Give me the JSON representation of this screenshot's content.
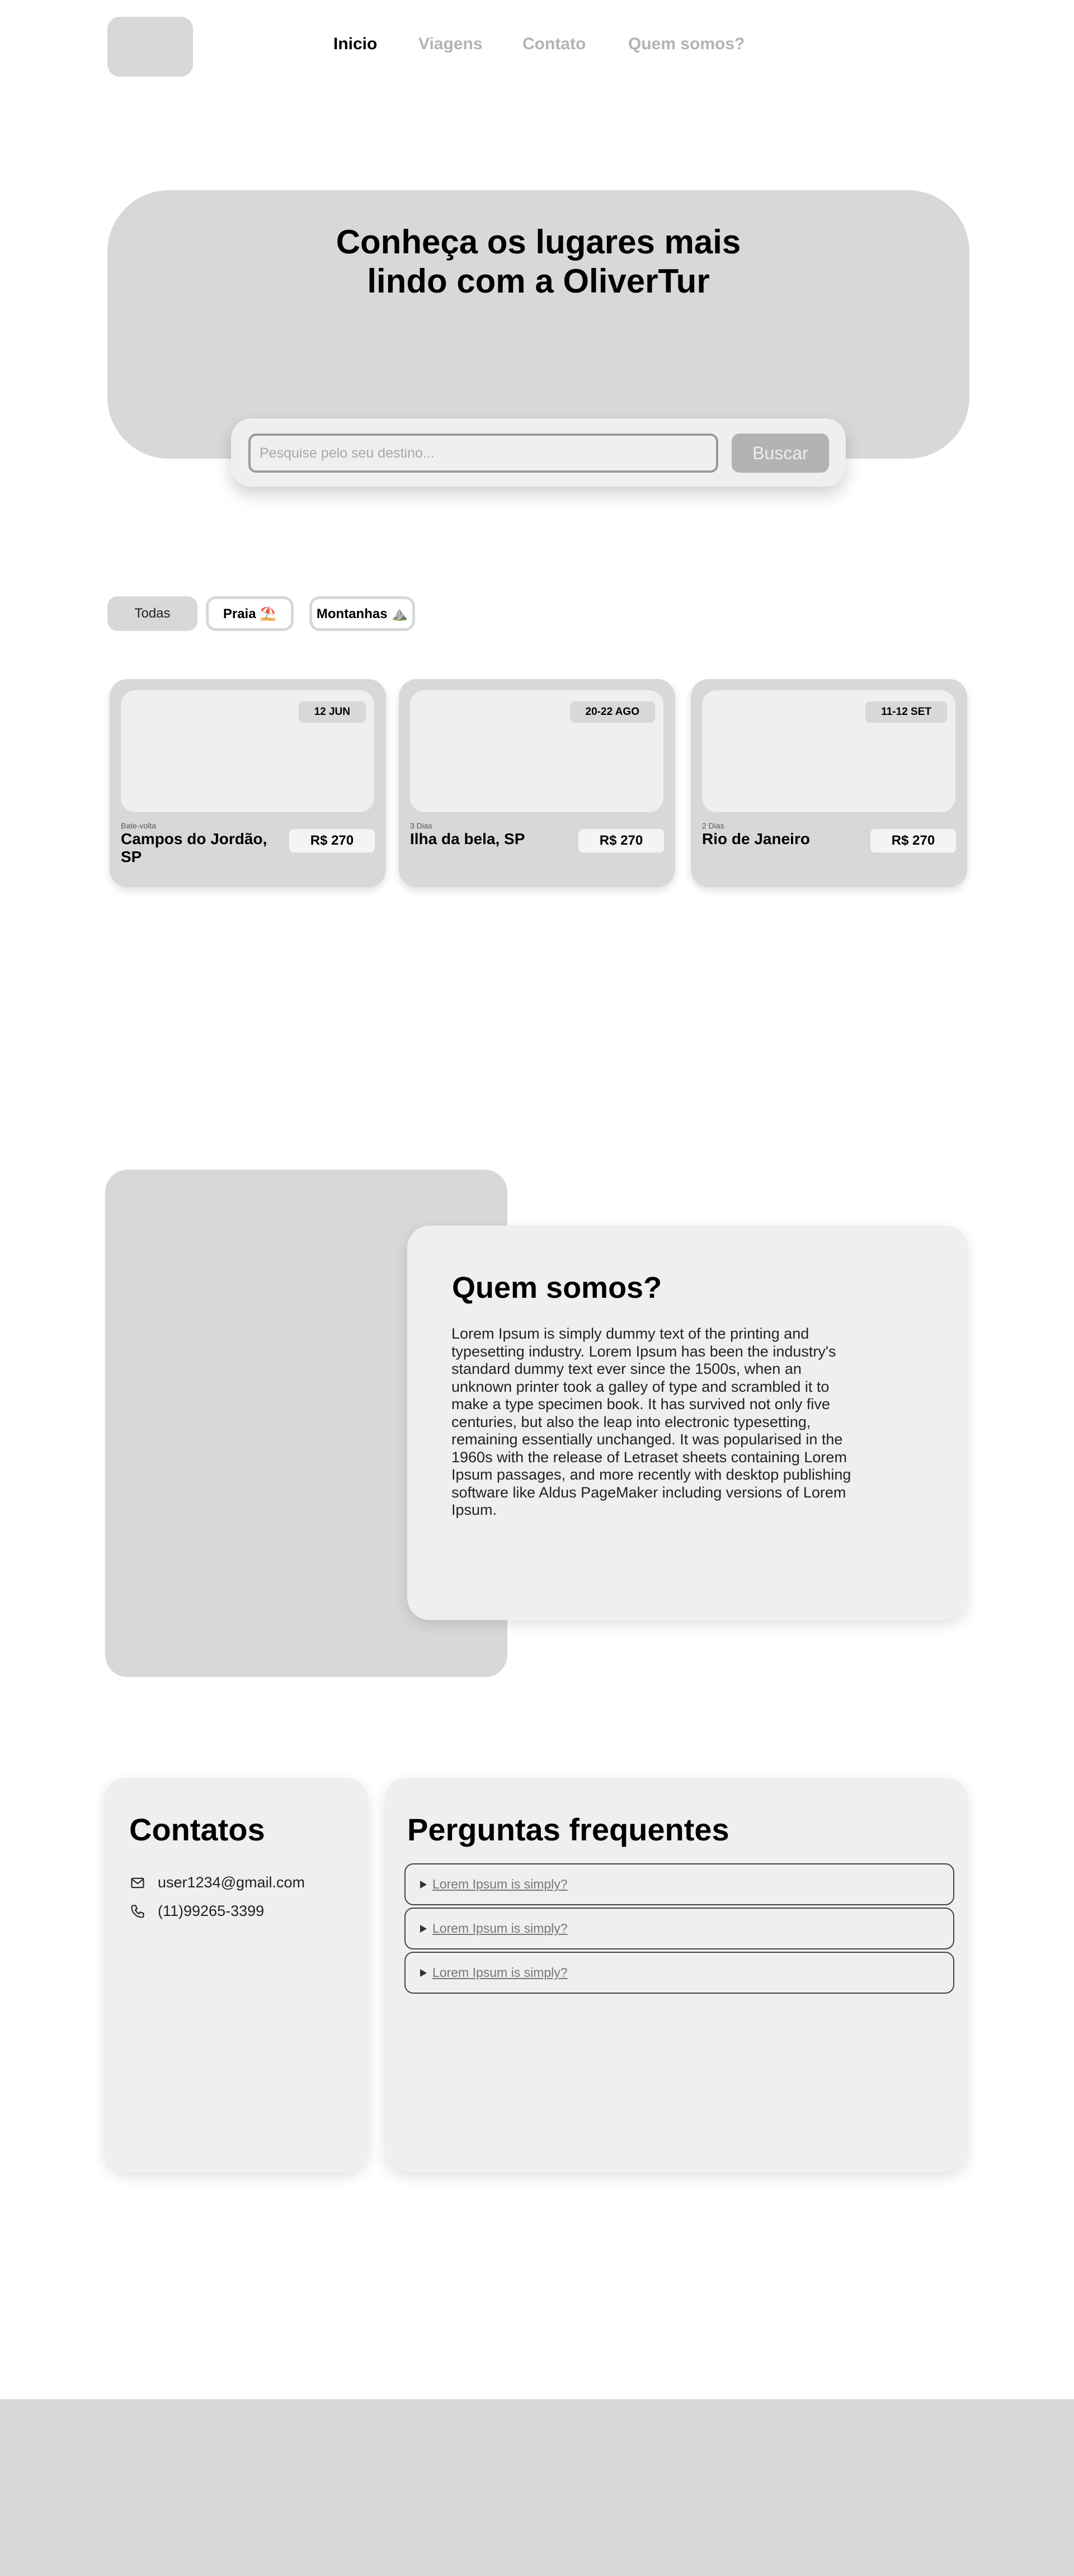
{
  "nav": {
    "items": [
      "Inicio",
      "Viagens",
      "Contato",
      "Quem somos?"
    ]
  },
  "hero": {
    "title": "Conheça os lugares mais lindo com a OliverTur",
    "search_placeholder": "Pesquise pelo seu destino...",
    "search_button": "Buscar"
  },
  "filters": [
    "Todas",
    "Praia ⛱️",
    "Montanhas ⛰️"
  ],
  "trips": [
    {
      "date": "12 JUN",
      "subtitle": "Bate-volta",
      "name": "Campos do Jordão, SP",
      "price": "R$ 270"
    },
    {
      "date": "20-22 AGO",
      "subtitle": "3 Dias",
      "name": "Ilha da bela, SP",
      "price": "R$ 270"
    },
    {
      "date": "11-12 SET",
      "subtitle": "2 Dias",
      "name": "Rio de Janeiro",
      "price": "R$ 270"
    }
  ],
  "about": {
    "title": "Quem somos?",
    "text": "Lorem Ipsum is simply dummy text of the printing and typesetting industry. Lorem Ipsum has been the industry's standard dummy text ever since the 1500s, when an unknown printer took a galley of type and scrambled it to make a type specimen book. It has survived not only five centuries, but also the leap into electronic typesetting, remaining essentially unchanged. It was popularised in the 1960s with the release of Letraset sheets containing Lorem Ipsum passages, and more recently with desktop publishing software like Aldus PageMaker including versions of Lorem Ipsum."
  },
  "contacts": {
    "title": "Contatos",
    "email": "user1234@gmail.com",
    "phone": "(11)99265-3399"
  },
  "faq": {
    "title": "Perguntas frequentes",
    "items": [
      "Lorem Ipsum is simply?",
      "Lorem Ipsum is simply?",
      "Lorem Ipsum is simply?"
    ]
  },
  "colors": {
    "placeholder_gray": "#d8d8d8",
    "light_gray": "#efefef",
    "inactive_nav": "#b3b3b3"
  }
}
